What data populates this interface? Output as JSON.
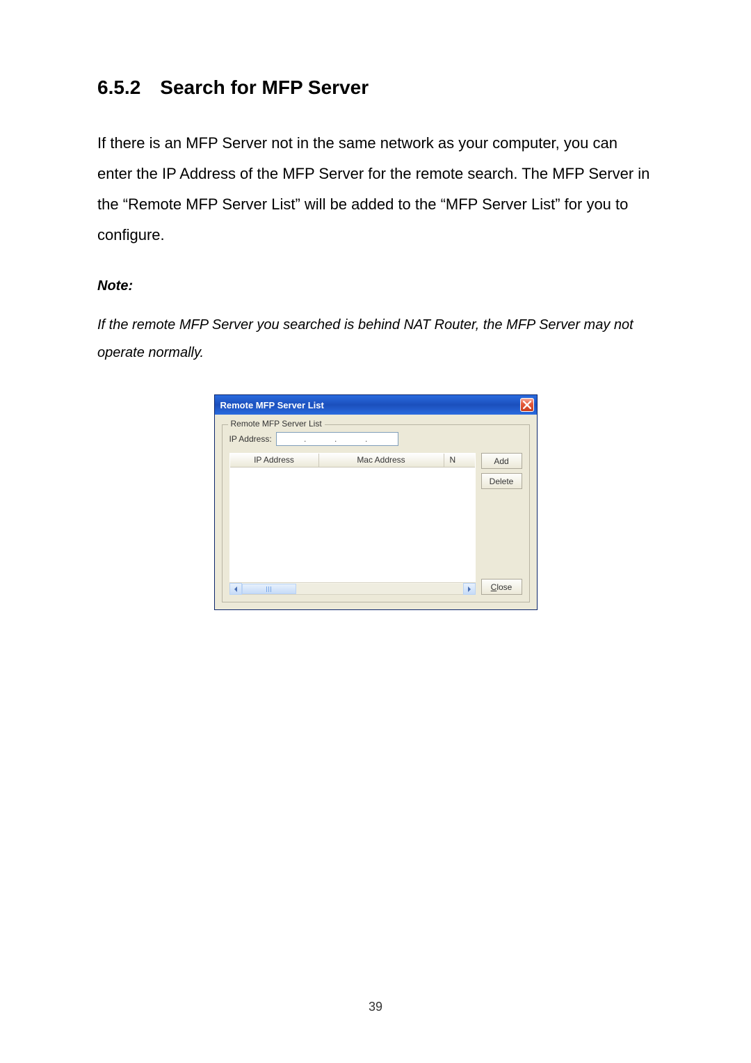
{
  "heading": {
    "number": "6.5.2",
    "title": "Search for MFP Server"
  },
  "body": "If there is an MFP Server not in the same network as your computer, you can enter the IP Address of the MFP Server for the remote search. The MFP Server in the “Remote MFP Server List” will be added to the “MFP Server List” for you to configure.",
  "note_label": "Note:",
  "note_text": "If the remote MFP Server you searched is behind NAT Router, the MFP Server may not operate normally.",
  "dialog": {
    "title": "Remote MFP Server List",
    "group_legend": "Remote MFP Server List",
    "ip_label": "IP Address:",
    "ip_parts": [
      "",
      "",
      "",
      ""
    ],
    "columns": {
      "c1": "IP Address",
      "c2": "Mac Address",
      "c3": "N"
    },
    "buttons": {
      "add": "Add",
      "delete": "Delete",
      "close_prefix": "C",
      "close_rest": "lose"
    }
  },
  "page_number": "39"
}
